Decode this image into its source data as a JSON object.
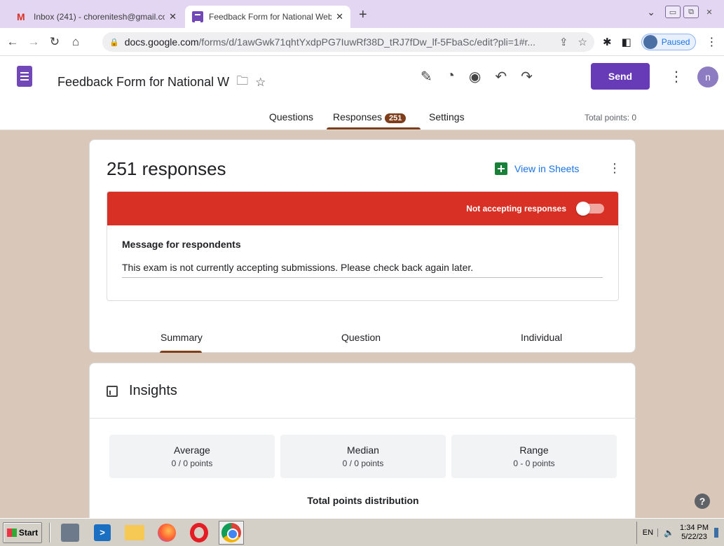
{
  "browser": {
    "tabs": [
      {
        "title": "Inbox (241) - chorenitesh@gmail.co",
        "icon": "gmail-icon",
        "active": false
      },
      {
        "title": "Feedback Form for National Webina",
        "icon": "google-forms-icon",
        "active": true
      }
    ],
    "url_domain": "docs.google.com",
    "url_path": "/forms/d/1awGwk71qhtYxdpPG7IuwRf38D_tRJ7fDw_lf-5FbaSc/edit?pli=1#r...",
    "profile_status": "Paused"
  },
  "form": {
    "title": "Feedback Form for National W",
    "send_label": "Send",
    "avatar_letter": "n",
    "tabs": {
      "questions": "Questions",
      "responses": "Responses",
      "responses_count": "251",
      "settings": "Settings"
    },
    "total_points": "Total points: 0"
  },
  "responses": {
    "heading": "251 responses",
    "view_in_sheets": "View in Sheets",
    "accepting_label": "Not accepting responses",
    "accepting": false,
    "message_label": "Message for respondents",
    "message_text": "This exam is not currently accepting submissions. Please check back again later.",
    "subtabs": [
      "Summary",
      "Question",
      "Individual"
    ],
    "active_subtab": "Summary"
  },
  "insights": {
    "heading": "Insights",
    "stats": [
      {
        "name": "Average",
        "value": "0 / 0 points"
      },
      {
        "name": "Median",
        "value": "0 / 0 points"
      },
      {
        "name": "Range",
        "value": "0 - 0 points"
      }
    ],
    "distribution_title": "Total points distribution"
  },
  "taskbar": {
    "start_label": "Start",
    "language": "EN",
    "time": "1:34 PM",
    "date": "5/22/23"
  },
  "colors": {
    "brand_purple": "#673ab7",
    "accent_brown": "#7f3d1a",
    "banner_red": "#d93025",
    "background_tan": "#d9c8b9"
  }
}
